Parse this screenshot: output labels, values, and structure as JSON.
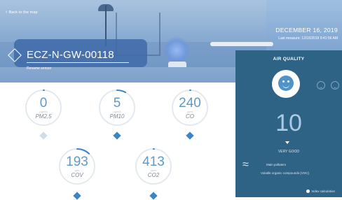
{
  "header": {
    "back_label": "Back to the map",
    "date": "DECEMBER 16, 2019",
    "last_measure": "Last measure: 12/16/2019 9:41:56 AM",
    "device_name": "ECZ-N-GW-00118",
    "rename_label": "Rename sensor"
  },
  "gauges": [
    {
      "value": "0",
      "unit": "µg/m3",
      "name": "PM2.5",
      "fill": 0.0,
      "marker_color": "#cfdde9"
    },
    {
      "value": "5",
      "unit": "µg/m3",
      "name": "PM10",
      "fill": 0.08,
      "marker_color": "#3a86c4"
    },
    {
      "value": "240",
      "unit": "ppm",
      "name": "CO",
      "fill": 0.0,
      "marker_color": "#3a86c4"
    },
    {
      "value": "193",
      "unit": "ppb",
      "name": "COV",
      "fill": 0.12,
      "marker_color": "#3a86c4"
    },
    {
      "value": "413",
      "unit": "ppm",
      "name": "CO2",
      "fill": 0.0,
      "marker_color": "#3a86c4"
    }
  ],
  "air_quality": {
    "title": "AIR QUALITY",
    "value": "10",
    "status": "VERY GOOD",
    "main_pollutants_label": "Main polluters",
    "voc_label": "Volatile organic compounds (VOC)",
    "info_label": "Index calculation",
    "panel_color": "#2f6386",
    "face_icon": "smiley-face-icon"
  }
}
